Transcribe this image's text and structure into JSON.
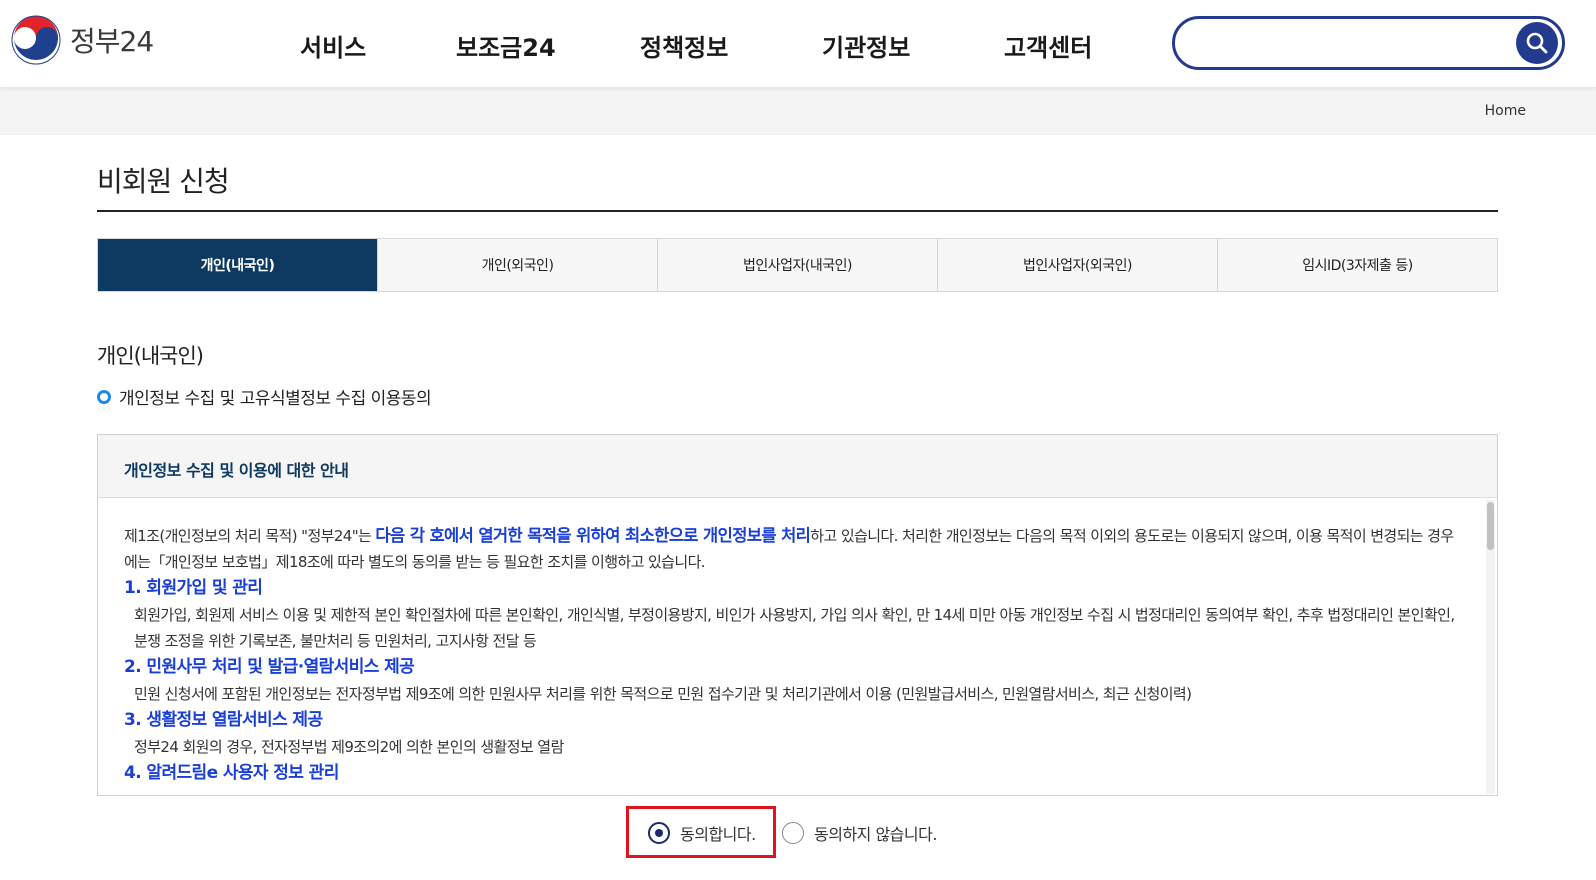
{
  "header": {
    "logo_text": "정부24",
    "nav": [
      "서비스",
      "보조금24",
      "정책정보",
      "기관정보",
      "고객센터"
    ],
    "search_placeholder": ""
  },
  "breadcrumb": {
    "home": "Home"
  },
  "page": {
    "title": "비회원 신청"
  },
  "tabs": [
    {
      "label": "개인(내국인)",
      "active": true
    },
    {
      "label": "개인(외국인)",
      "active": false
    },
    {
      "label": "법인사업자(내국인)",
      "active": false
    },
    {
      "label": "법인사업자(외국인)",
      "active": false
    },
    {
      "label": "임시ID(3자제출 등)",
      "active": false
    }
  ],
  "section": {
    "title": "개인(내국인)",
    "subtitle": "개인정보 수집 및 고유식별정보 수집 이용동의"
  },
  "agreement": {
    "heading": "개인정보 수집 및 이용에 대한 안내",
    "intro_a": "제1조(개인정보의 처리 목적) \"정부24\"는 ",
    "intro_highlight": "다음 각 호에서 열거한 목적을 위하여 최소한으로 개인정보를 처리",
    "intro_b": "하고 있습니다. 처리한 개인정보는 다음의 목적 이외의 용도로는 이용되지 않으며, 이용 목적이 변경되는 경우에는「개인정보 보호법」제18조에 따라 별도의 동의를 받는 등 필요한 조치를 이행하고 있습니다.",
    "items": [
      {
        "head": "1. 회원가입 및 관리",
        "desc": "회원가입, 회원제 서비스 이용 및 제한적 본인 확인절차에 따른 본인확인, 개인식별, 부정이용방지, 비인가 사용방지, 가입 의사 확인, 만 14세 미만 아동 개인정보 수집 시 법정대리인 동의여부 확인, 추후 법정대리인 본인확인, 분쟁 조정을 위한 기록보존, 불만처리 등 민원처리, 고지사항 전달 등"
      },
      {
        "head": "2. 민원사무 처리 및 발급·열람서비스 제공",
        "desc": "민원 신청서에 포함된 개인정보는 전자정부법 제9조에 의한 민원사무 처리를 위한 목적으로 민원 접수기관 및 처리기관에서 이용 (민원발급서비스, 민원열람서비스, 최근 신청이력)"
      },
      {
        "head": "3. 생활정보 열람서비스 제공",
        "desc": "정부24 회원의 경우, 전자정부법 제9조의2에 의한 본인의 생활정보 열람"
      },
      {
        "head": "4. 알려드림e 사용자 정보 관리",
        "desc": ""
      }
    ]
  },
  "consent": {
    "agree": "동의합니다.",
    "disagree": "동의하지 않습니다.",
    "selected": "agree"
  },
  "colors": {
    "brand_navy": "#0e3a62",
    "search_blue": "#243a8f",
    "highlight_blue": "#1a3fd6",
    "highlight_red": "#e0141e"
  }
}
